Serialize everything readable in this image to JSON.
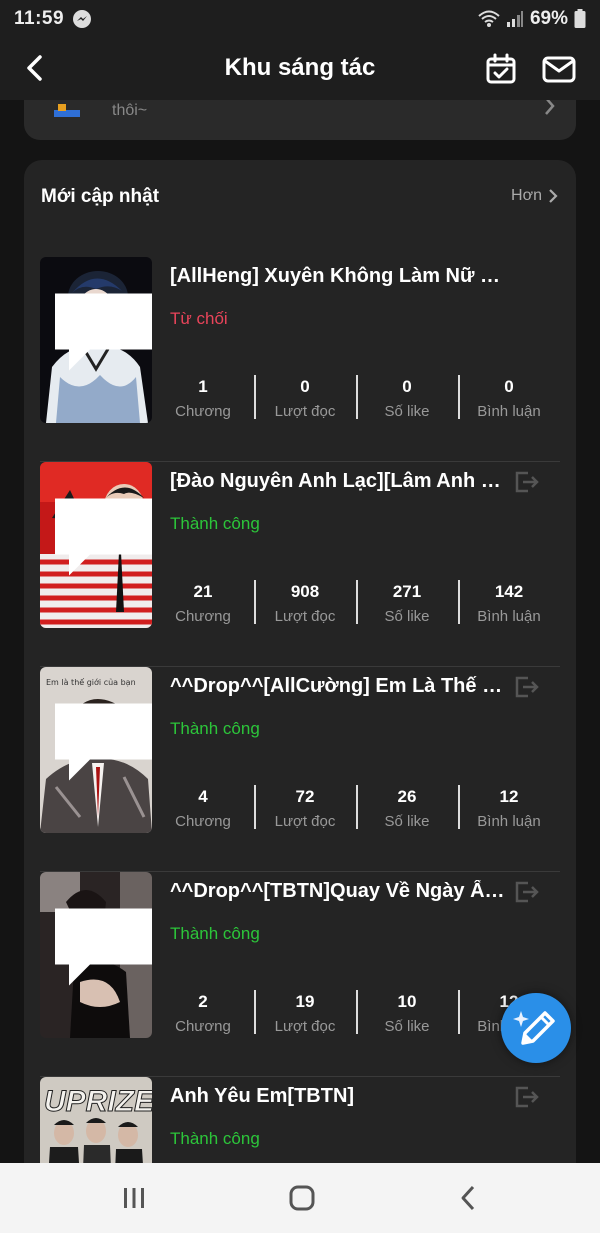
{
  "status_bar": {
    "time": "11:59",
    "battery": "69%"
  },
  "header": {
    "title": "Khu sáng tác"
  },
  "previous_card": {
    "text": "thôi~"
  },
  "section": {
    "title": "Mới cập nhật",
    "more": "Hơn"
  },
  "stat_labels": {
    "chapters": "Chương",
    "reads": "Lượt đọc",
    "likes": "Số like",
    "comments": "Bình luận"
  },
  "stories": [
    {
      "title": "[AllHeng] Xuyên Không Làm Nữ Phụ?!!",
      "status": "Từ chối",
      "status_color": "#e8445a",
      "chapters": "1",
      "reads": "0",
      "likes": "0",
      "comments": "0",
      "has_exit": false
    },
    {
      "title": "[Đào Nguyên Anh Lạc][Lâm Anh X ...",
      "status": "Thành công",
      "status_color": "#2cc53a",
      "chapters": "21",
      "reads": "908",
      "likes": "271",
      "comments": "142",
      "has_exit": true
    },
    {
      "title": "^^Drop^^[AllCường] Em Là Thế Giới...",
      "status": "Thành công",
      "status_color": "#2cc53a",
      "chapters": "4",
      "reads": "72",
      "likes": "26",
      "comments": "12",
      "has_exit": true
    },
    {
      "title": "^^Drop^^[TBTN]Quay Về Ngày Ấy(P...",
      "status": "Thành công",
      "status_color": "#2cc53a",
      "chapters": "2",
      "reads": "19",
      "likes": "10",
      "comments": "12",
      "has_exit": true
    },
    {
      "title": "Anh Yêu Em[TBTN]",
      "status": "Thành công",
      "status_color": "#2cc53a",
      "chapters": "",
      "reads": "",
      "likes": "",
      "comments": "",
      "has_exit": true
    }
  ],
  "covers": [
    {
      "text": ""
    },
    {
      "text": ""
    },
    {
      "text": "Em là thế giới của bạn"
    },
    {
      "text": ""
    },
    {
      "text": "UPRIZE"
    }
  ],
  "colors": {
    "accent": "#2a8fe8",
    "success": "#2cc53a",
    "rejected": "#e8445a",
    "panel": "#242424"
  }
}
